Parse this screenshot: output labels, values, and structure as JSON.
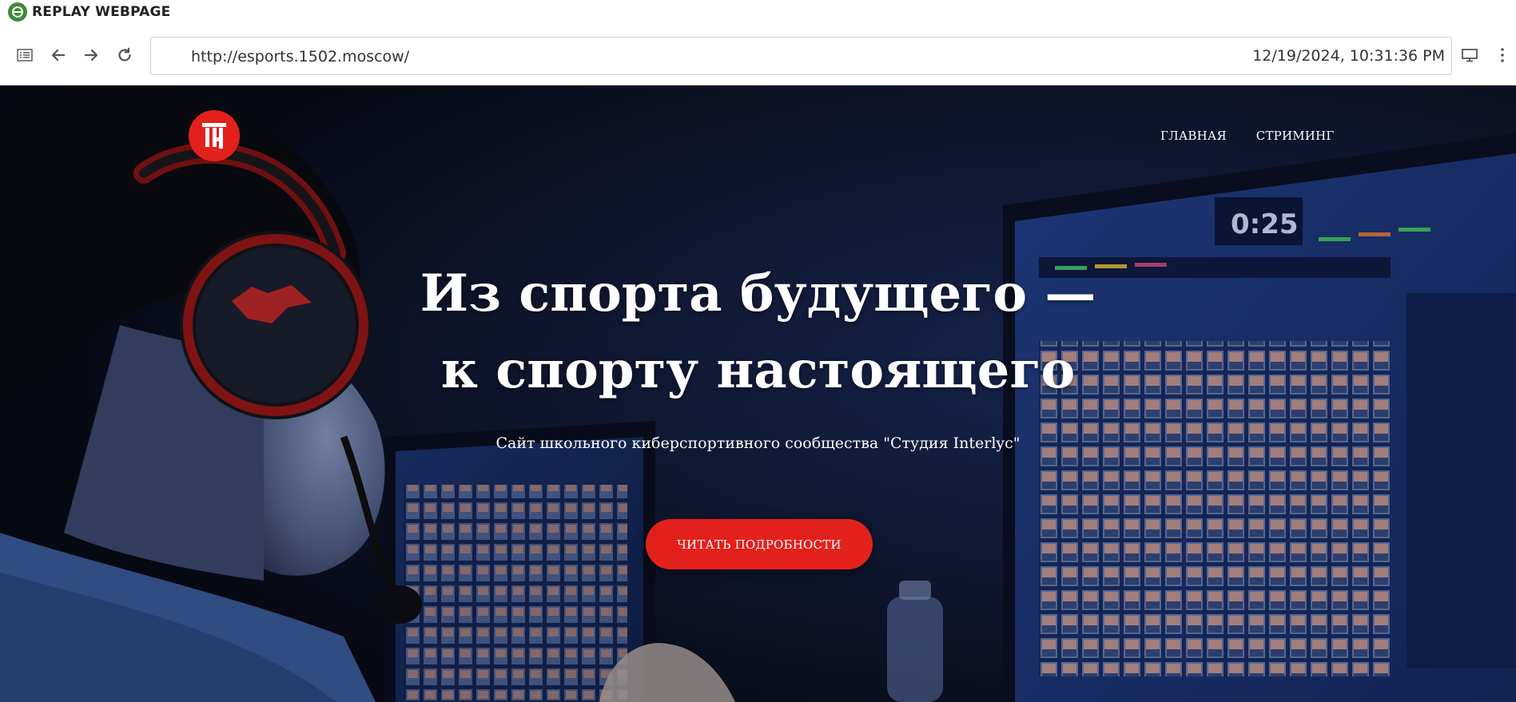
{
  "replay": {
    "title": "REPLAY WEBPAGE",
    "icon": "globe-icon",
    "accent": "#3f8a3a"
  },
  "browser": {
    "url": "http://esports.1502.moscow/",
    "timestamp": "12/19/2024, 10:31:36 PM",
    "icons": [
      "list-icon",
      "back-arrow-icon",
      "forward-arrow-icon",
      "reload-icon",
      "monitor-icon",
      "more-vertical-icon"
    ]
  },
  "site": {
    "logo_icon": "site-logo-icon",
    "brand_color": "#e3211c",
    "nav": [
      {
        "label": "ГЛАВНАЯ"
      },
      {
        "label": "СТРИМИНГ"
      }
    ],
    "hero": {
      "headline_line1": "Из спорта будущего —",
      "headline_line2": "к спорту настоящего",
      "subtitle": "Сайт школьного киберспортивного сообщества \"Студия Interlyc\"",
      "cta_label": "ЧИТАТЬ ПОДРОБНОСТИ"
    }
  }
}
